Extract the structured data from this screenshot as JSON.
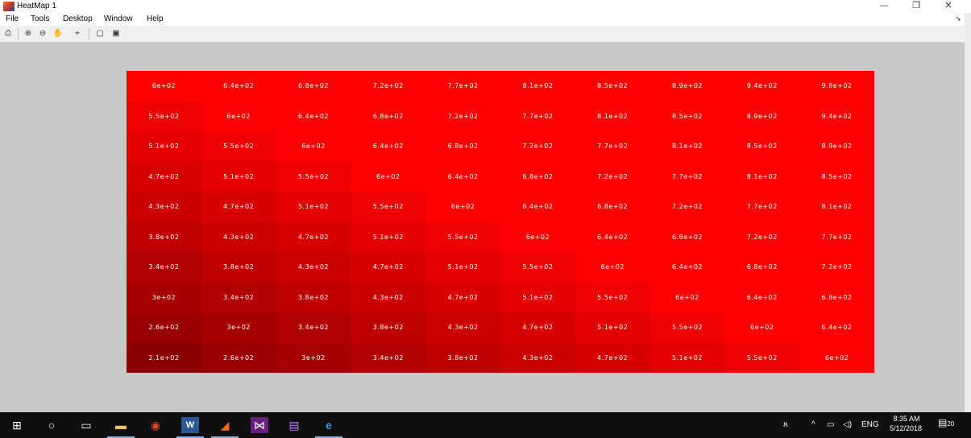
{
  "window": {
    "title": "HeatMap 1",
    "minimize_glyph": "—",
    "restore_glyph": "❐",
    "close_glyph": "✕"
  },
  "menu": {
    "items": [
      "File",
      "Tools",
      "Desktop",
      "Window",
      "Help"
    ],
    "overflow_glyph": "➘"
  },
  "toolbar": {
    "icons": [
      "print-icon",
      "zoom-in-icon",
      "zoom-out-icon",
      "pan-hand-icon",
      "data-cursor-icon",
      "hide-plot-tools-icon",
      "show-plot-tools-icon"
    ]
  },
  "heatmap": {
    "rows": 10,
    "cols": 10,
    "labels": [
      [
        "6e+02",
        "6.4e+02",
        "6.8e+02",
        "7.2e+02",
        "7.7e+02",
        "8.1e+02",
        "8.5e+02",
        "8.9e+02",
        "9.4e+02",
        "9.8e+02"
      ],
      [
        "5.5e+02",
        "6e+02",
        "6.4e+02",
        "6.8e+02",
        "7.2e+02",
        "7.7e+02",
        "8.1e+02",
        "8.5e+02",
        "8.9e+02",
        "9.4e+02"
      ],
      [
        "5.1e+02",
        "5.5e+02",
        "6e+02",
        "6.4e+02",
        "6.8e+02",
        "7.2e+02",
        "7.7e+02",
        "8.1e+02",
        "8.5e+02",
        "8.9e+02"
      ],
      [
        "4.7e+02",
        "5.1e+02",
        "5.5e+02",
        "6e+02",
        "6.4e+02",
        "6.8e+02",
        "7.2e+02",
        "7.7e+02",
        "8.1e+02",
        "8.5e+02"
      ],
      [
        "4.3e+02",
        "4.7e+02",
        "5.1e+02",
        "5.5e+02",
        "6e+02",
        "6.4e+02",
        "6.8e+02",
        "7.2e+02",
        "7.7e+02",
        "8.1e+02"
      ],
      [
        "3.8e+02",
        "4.3e+02",
        "4.7e+02",
        "5.1e+02",
        "5.5e+02",
        "6e+02",
        "6.4e+02",
        "6.8e+02",
        "7.2e+02",
        "7.7e+02"
      ],
      [
        "3.4e+02",
        "3.8e+02",
        "4.3e+02",
        "4.7e+02",
        "5.1e+02",
        "5.5e+02",
        "6e+02",
        "6.4e+02",
        "6.8e+02",
        "7.2e+02"
      ],
      [
        "3e+02",
        "3.4e+02",
        "3.8e+02",
        "4.3e+02",
        "4.7e+02",
        "5.1e+02",
        "5.5e+02",
        "6e+02",
        "6.4e+02",
        "6.8e+02"
      ],
      [
        "2.6e+02",
        "3e+02",
        "3.4e+02",
        "3.8e+02",
        "4.3e+02",
        "4.7e+02",
        "5.1e+02",
        "5.5e+02",
        "6e+02",
        "6.4e+02"
      ],
      [
        "2.1e+02",
        "2.6e+02",
        "3e+02",
        "3.4e+02",
        "3.8e+02",
        "4.3e+02",
        "4.7e+02",
        "5.1e+02",
        "5.5e+02",
        "6e+02"
      ]
    ],
    "color_low": "#8b0000",
    "color_high": "#ff0000",
    "value_saturation": 600
  },
  "taskbar": {
    "apps": [
      {
        "name": "start-icon",
        "glyph": "⊞"
      },
      {
        "name": "search-icon",
        "glyph": "○"
      },
      {
        "name": "task-view-icon",
        "glyph": "▭"
      },
      {
        "name": "file-explorer-icon",
        "glyph": "▬"
      },
      {
        "name": "chrome-icon",
        "glyph": "◉"
      },
      {
        "name": "word-icon",
        "glyph": "W"
      },
      {
        "name": "matlab-icon",
        "glyph": "◢"
      },
      {
        "name": "visual-studio-icon",
        "glyph": "⋈"
      },
      {
        "name": "winrar-icon",
        "glyph": "▤"
      },
      {
        "name": "edge-icon",
        "glyph": "e"
      }
    ],
    "tray": {
      "people_glyph": "ጸ",
      "chevron_glyph": "^",
      "battery_glyph": "▭",
      "volume_glyph": "◁)",
      "language": "ENG",
      "time": "8:35 AM",
      "date": "5/12/2018",
      "notification_count": "20"
    }
  },
  "colors": {
    "background": "#c8c8c8",
    "taskbar": "#0f0f10",
    "accent": "#7fb0e6"
  }
}
